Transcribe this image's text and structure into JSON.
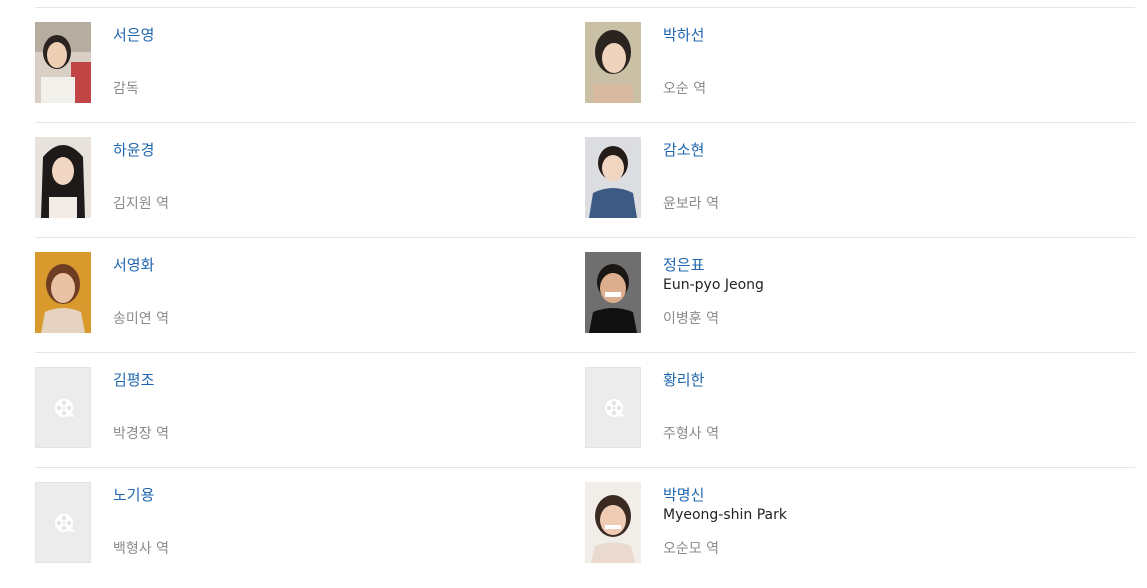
{
  "cast": [
    {
      "left": {
        "name": "서은영",
        "name_en": "",
        "role": "감독",
        "photo_icon": "person-photo"
      },
      "right": {
        "name": "박하선",
        "name_en": "",
        "role": "오순 역",
        "photo_icon": "person-photo"
      }
    },
    {
      "left": {
        "name": "하윤경",
        "name_en": "",
        "role": "김지원 역",
        "photo_icon": "person-photo"
      },
      "right": {
        "name": "감소현",
        "name_en": "",
        "role": "윤보라 역",
        "photo_icon": "person-photo"
      }
    },
    {
      "left": {
        "name": "서영화",
        "name_en": "",
        "role": "송미연 역",
        "photo_icon": "person-photo"
      },
      "right": {
        "name": "정은표",
        "name_en": "Eun-pyo Jeong",
        "role": "이병훈 역",
        "photo_icon": "person-photo"
      }
    },
    {
      "left": {
        "name": "김평조",
        "name_en": "",
        "role": "박경장 역",
        "photo_icon": "film-reel-icon"
      },
      "right": {
        "name": "황리한",
        "name_en": "",
        "role": "주형사 역",
        "photo_icon": "film-reel-icon"
      }
    },
    {
      "left": {
        "name": "노기용",
        "name_en": "",
        "role": "백형사 역",
        "photo_icon": "film-reel-icon"
      },
      "right": {
        "name": "박명신",
        "name_en": "Myeong-shin Park",
        "role": "오순모 역",
        "photo_icon": "person-photo"
      }
    }
  ],
  "colors": {
    "name_link": "#2067b0",
    "role_text": "#8b8b8b",
    "divider": "#e6e6e6",
    "placeholder_bg": "#ececec"
  }
}
